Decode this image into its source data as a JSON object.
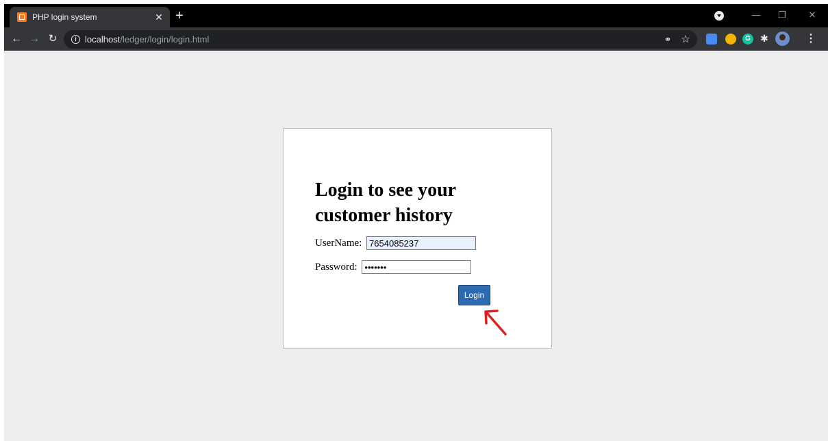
{
  "browser": {
    "tab_title": "PHP login system",
    "tab_close_glyph": "✕",
    "new_tab_glyph": "+",
    "url_host": "localhost",
    "url_path": "/ledger/login/login.html",
    "icons": [
      "back-arrow-icon",
      "forward-arrow-icon",
      "reload-icon",
      "info-icon",
      "key-icon",
      "star-icon",
      "translate-icon",
      "compass-icon",
      "grammarly-icon",
      "puzzle-icon",
      "avatar",
      "menu-icon"
    ],
    "grammarly_letter": "G"
  },
  "login": {
    "heading": "Login to see your customer history",
    "username_label": "UserName:",
    "username_value": "7654085237",
    "password_label": "Password:",
    "password_value": "*******",
    "button_label": "Login"
  },
  "colors": {
    "page_bg": "#eeeeee",
    "button_bg": "#2e6ab1",
    "autofill_bg": "#e8f0fe",
    "annotation_arrow": "#e02020"
  }
}
